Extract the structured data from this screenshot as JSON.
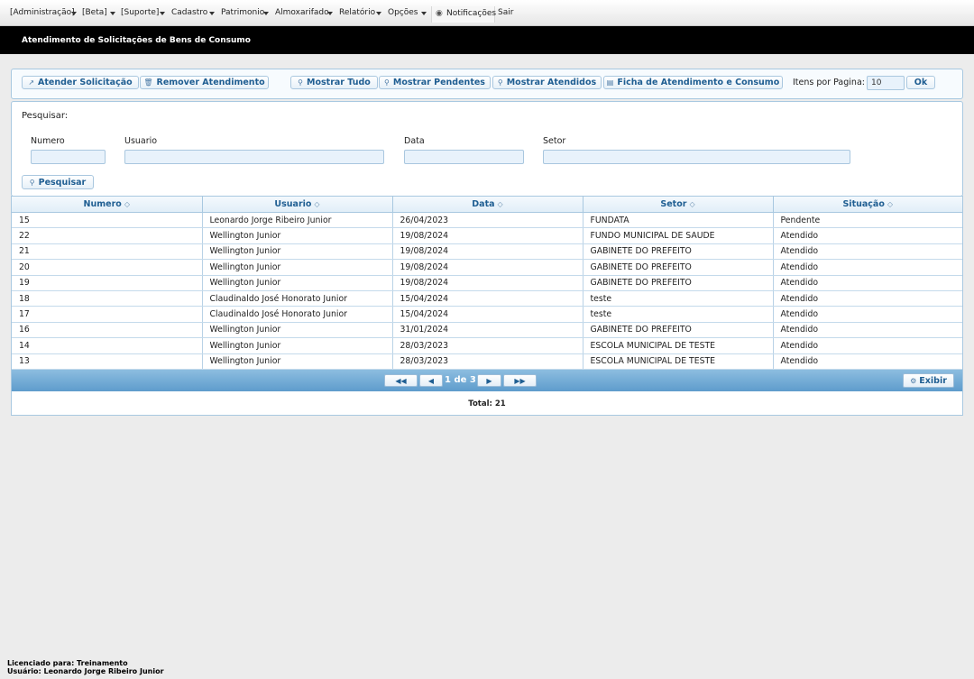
{
  "menu": {
    "items": [
      "[Administração]",
      "[Beta]",
      "[Suporte]",
      "Cadastro",
      "Patrimonio",
      "Almoxarifado",
      "Relatório",
      "Opções"
    ],
    "notifications": "Notificações",
    "logout": "Sair"
  },
  "title": "Atendimento de Solicitações de Bens de Consumo",
  "toolbar": {
    "attend": "Atender Solicitação",
    "remove": "Remover Atendimento",
    "show_all": "Mostrar Tudo",
    "show_pending": "Mostrar Pendentes",
    "show_attended": "Mostrar Atendidos",
    "record": "Ficha de Atendimento e Consumo",
    "per_page_label": "Itens por Pagina:",
    "per_page_value": "10",
    "ok": "Ok"
  },
  "filter": {
    "heading": "Pesquisar:",
    "numero": "Numero",
    "usuario": "Usuario",
    "data": "Data",
    "setor": "Setor",
    "search_button": "Pesquisar"
  },
  "table": {
    "headers": [
      "Numero",
      "Usuario",
      "Data",
      "Setor",
      "Situação"
    ],
    "rows": [
      [
        "15",
        "Leonardo Jorge Ribeiro Junior",
        "26/04/2023",
        "FUNDATA",
        "Pendente"
      ],
      [
        "22",
        "Wellington Junior",
        "19/08/2024",
        "FUNDO MUNICIPAL DE SAUDE",
        "Atendido"
      ],
      [
        "21",
        "Wellington Junior",
        "19/08/2024",
        "GABINETE DO PREFEITO",
        "Atendido"
      ],
      [
        "20",
        "Wellington Junior",
        "19/08/2024",
        "GABINETE DO PREFEITO",
        "Atendido"
      ],
      [
        "19",
        "Wellington Junior",
        "19/08/2024",
        "GABINETE DO PREFEITO",
        "Atendido"
      ],
      [
        "18",
        "Claudinaldo José Honorato Junior",
        "15/04/2024",
        "teste",
        "Atendido"
      ],
      [
        "17",
        "Claudinaldo José Honorato Junior",
        "15/04/2024",
        "teste",
        "Atendido"
      ],
      [
        "16",
        "Wellington Junior",
        "31/01/2024",
        "GABINETE DO PREFEITO",
        "Atendido"
      ],
      [
        "14",
        "Wellington Junior",
        "28/03/2023",
        "ESCOLA MUNICIPAL DE TESTE",
        "Atendido"
      ],
      [
        "13",
        "Wellington Junior",
        "28/03/2023",
        "ESCOLA MUNICIPAL DE TESTE",
        "Atendido"
      ]
    ]
  },
  "pager": {
    "first": "◀◀",
    "prev": "◀",
    "info": "1 de 3",
    "next": "▶",
    "last": "▶▶",
    "show": "Exibir"
  },
  "total": "Total: 21",
  "footer": {
    "license": "Licenciado para: Treinamento",
    "user": "Usuário: Leonardo Jorge Ribeiro Junior"
  }
}
